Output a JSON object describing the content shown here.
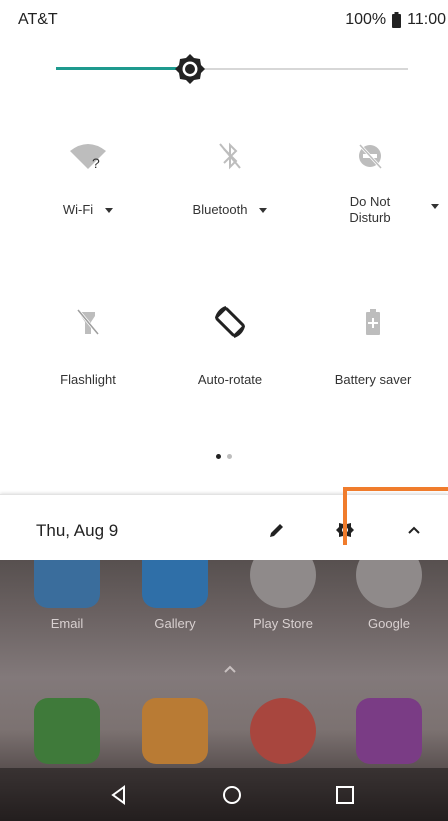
{
  "status_bar": {
    "carrier": "AT&T",
    "battery": "100%",
    "time": "11:00"
  },
  "brightness": {
    "level": 0.38,
    "accent_color": "#1e9a8e"
  },
  "quick_settings": {
    "tiles": [
      {
        "label": "Wi-Fi",
        "icon": "wifi-unknown-icon",
        "has_dropdown": true
      },
      {
        "label": "Bluetooth",
        "icon": "bluetooth-off-icon",
        "has_dropdown": true
      },
      {
        "label_line1": "Do Not",
        "label_line2": "Disturb",
        "icon": "do-not-disturb-off-icon",
        "has_dropdown": true
      },
      {
        "label": "Flashlight",
        "icon": "flashlight-off-icon"
      },
      {
        "label": "Auto-rotate",
        "icon": "auto-rotate-icon"
      },
      {
        "label": "Battery saver",
        "icon": "battery-saver-icon"
      }
    ],
    "page_current": 1,
    "page_count": 2
  },
  "footer": {
    "date": "Thu, Aug 9",
    "edit_icon": "pencil-icon",
    "settings_icon": "gear-icon",
    "collapse_icon": "chevron-up-icon",
    "highlight_color": "#f07c2c"
  },
  "home": {
    "apps_row1": [
      {
        "label": "Email",
        "color": "#3a7fc7"
      },
      {
        "label": "Gallery",
        "color": "#2e86d6"
      },
      {
        "label": "Play Store",
        "color": "#e6e6e6"
      },
      {
        "label": "Google",
        "color": "#e6e6e6"
      }
    ],
    "dock": [
      {
        "name": "phone-app-icon",
        "color": "#4caf50"
      },
      {
        "name": "messages-app-icon",
        "color": "#f2a23a"
      },
      {
        "name": "chrome-app-icon",
        "color": "#db4437"
      },
      {
        "name": "camera-app-icon",
        "color": "#9c27b0"
      }
    ]
  }
}
